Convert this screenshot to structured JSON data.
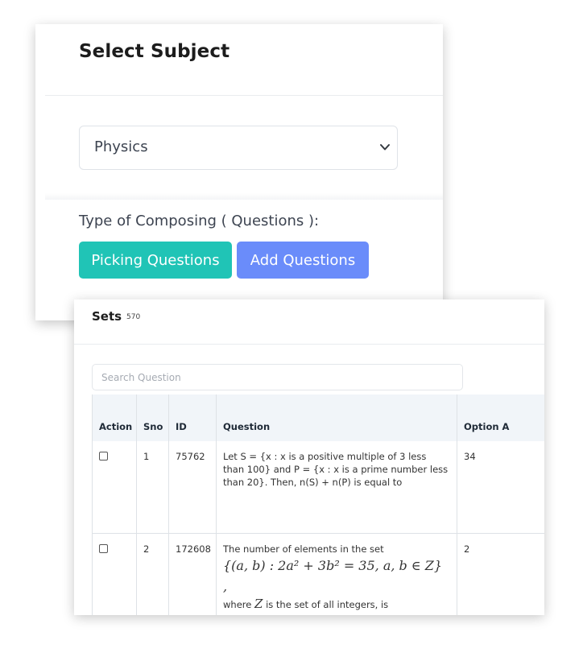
{
  "subject": {
    "title": "Select Subject",
    "selected": "Physics",
    "compose_label": "Type of Composing ( Questions ):",
    "buttons": {
      "pick": "Picking Questions",
      "add": "Add Questions"
    },
    "colors": {
      "pick": "#20c4b6",
      "add": "#6a8cfa"
    }
  },
  "sets": {
    "title": "Sets",
    "count": "570",
    "search_placeholder": "Search Question",
    "columns": [
      "Action",
      "Sno",
      "ID",
      "Question",
      "Option A"
    ],
    "rows": [
      {
        "sno": "1",
        "id": "75762",
        "question": "Let S = {x : x is a positive multiple of 3 less than 100} and P = {x : x is a prime number less than 20}. Then, n(S) + n(P) is equal to",
        "option_a": "34"
      },
      {
        "sno": "2",
        "id": "172608",
        "question_intro": "The number of elements in the set",
        "question_math": "{(a, b) : 2a² + 3b² = 35, a, b ∈ Z} ,",
        "question_where": "where",
        "question_symbol": "Z",
        "question_end": "is the set of all integers, is",
        "option_a": "2"
      }
    ]
  }
}
